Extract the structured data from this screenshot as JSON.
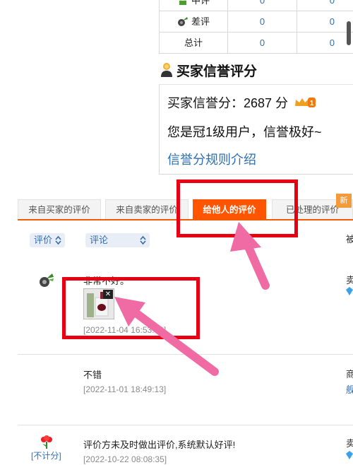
{
  "stats_table": {
    "rows": [
      {
        "label": "中评",
        "count_a": "0",
        "count_b": "0",
        "icon": "neutral-rating-icon"
      },
      {
        "label": "差评",
        "count_a": "0",
        "count_b": "0",
        "icon": "negative-rating-icon"
      },
      {
        "label": "总计",
        "count_a": "0",
        "count_b": "0"
      }
    ]
  },
  "credit": {
    "heading": "买家信誉评分",
    "score_line": "买家信誉分：2687 分",
    "level_line": "您是冠1级用户，信誉极好~",
    "rules_link": "信誉分规则介绍",
    "crown_icon": "crown-level-1-icon",
    "crown_number": "1"
  },
  "tabs": [
    {
      "label": "来自买家的评价",
      "active": false
    },
    {
      "label": "来自卖家的评价",
      "active": false
    },
    {
      "label": "给他人的评价",
      "active": true
    },
    {
      "label": "已处理的评价",
      "active": false
    }
  ],
  "new_badge": "新",
  "filters": {
    "rating_label": "评价",
    "comment_label": "评论",
    "cut_header": "被"
  },
  "comments": [
    {
      "text": "非常不好。",
      "date": "[2022-11-04 16:53:40]",
      "rating_icon": "negative-rating-icon",
      "side_label": "卖",
      "side_icon": "diamond-icon"
    },
    {
      "text": "不错",
      "date": "[2022-11-01 18:49:13]",
      "side_label": "商",
      "side_sub": "舰"
    },
    {
      "text": "评价方未及时做出评价,系统默认好评!",
      "date": "[2022-10-22 08:08:35]",
      "rating_icon": "positive-rating-icon",
      "rating_note": "[不计分]",
      "side_label": "卖",
      "side_icon": "diamond-icon"
    }
  ],
  "colors": {
    "accent_orange": "#ff5500",
    "link_blue": "#2f6fb0",
    "annotation_red": "#e60012",
    "annotation_pink": "#f06aa4"
  }
}
